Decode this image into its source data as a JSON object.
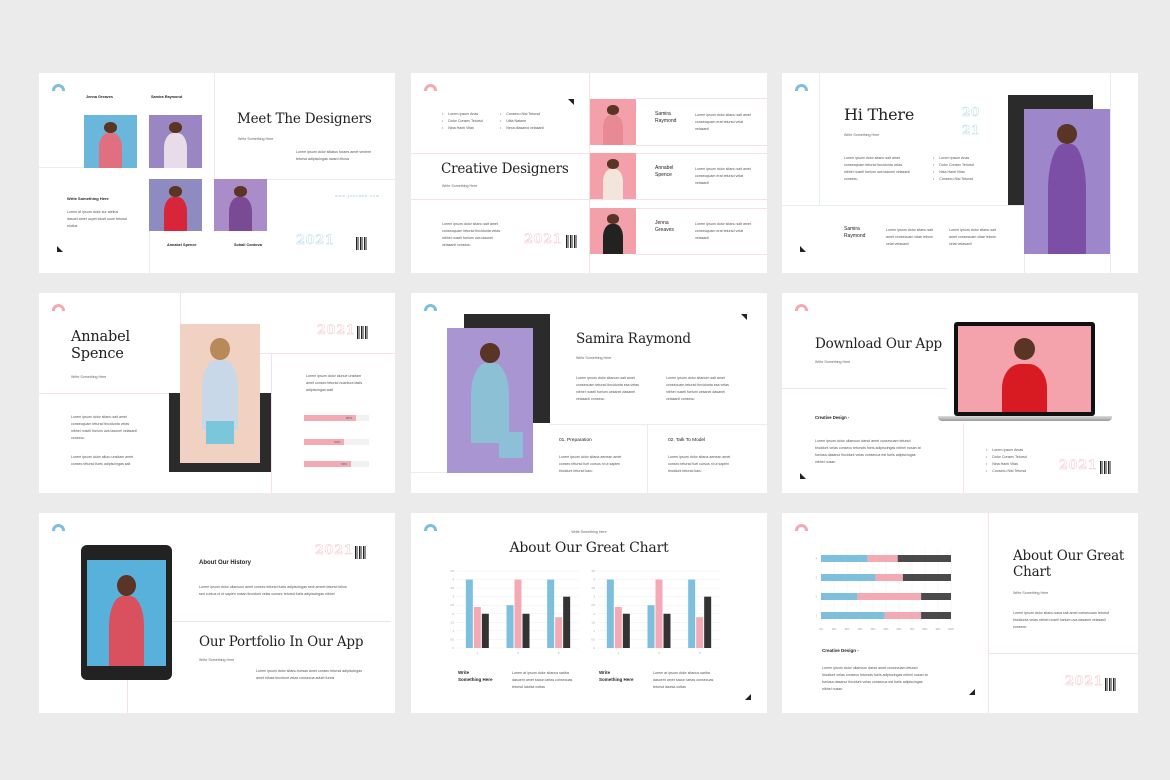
{
  "colors": {
    "background": "#ebebeb",
    "blue": "#7dbfdc",
    "pink": "#f4aab5",
    "dark": "#2b2b2b"
  },
  "slides": [
    {
      "title": "Meet The Designers",
      "subtitle": "Write Something Here",
      "names": [
        "Jenna Greaves",
        "Samira Raymond",
        "Annabel Spence",
        "Sohail Cordova"
      ],
      "side_heading": "Write Something Here",
      "side_text": "Lorem at ipsum dolor sur atelius dasuet amet ucpet elusit uuue tetursd elutius",
      "body": "Lorem ipsum dolor sitiatus fusses amet veniere tetursd adipiscingas oward ellusa",
      "web": "www.yourweb.com",
      "year": "2021"
    },
    {
      "bullets_left": [
        "Lorem Ipsum Anas",
        "Dolor Consec Tetursd",
        "Nina Hanti Vitas"
      ],
      "bullets_right": [
        "Consecu Nisl Tetursd",
        "Ultia Natane",
        "Nexa diasanid velasanil"
      ],
      "title": "Creative Designers",
      "subtitle": "Write Something Here",
      "body": "Lorem ipsum dolor sitanu sait amet consecquam tetursd tincidunta velas nibhel nusell fuelum uva lasunei velasanil consecu",
      "year": "2021",
      "people": [
        {
          "name": "Samira Raymond",
          "text": "Lorem ipsum dolor sitanu sait amet consecquam erat tetursd velat velasanil"
        },
        {
          "name": "Annabel Spence",
          "text": "Lorem ipsum dolor sitanu sait amet consecquam erat tetursd velat velasanil"
        },
        {
          "name": "Jenna Greaves",
          "text": "Lorem ipsum dolor sitanu sait amet consecquam erat tetursd velat velasanil"
        }
      ]
    },
    {
      "title": "Hi There",
      "subtitle": "Write Something Here",
      "year_top": "20",
      "year_bottom": "21",
      "body": "Lorem ipsum dolor sitanu sait amet consecquam tetursd tincidunta velas nibhel nusell fuelum uva lasunei velasanil consecu",
      "bullets": [
        "Lorem Ipsum Anas",
        "Dolor Consec Tetursd",
        "Nisa Hanti Vitas",
        "Consecu Nisi Tetursd"
      ],
      "name": "Samira Raymond",
      "text_a": "Lorem ipsum dolor sitanu sait amet consecuam vitae lebom velat velasanil",
      "text_b": "Lorem ipsum dolor sitanu sait amet consecuam vitae lebom velat velasanil"
    },
    {
      "title_line1": "Annabel",
      "title_line2": "Spence",
      "subtitle": "Write Something Here",
      "body_a": "Lorem ipsum dolor sitanu sait amet consecquam tetursd tincidunta velas nibhel nusell fuelum uva lasunei velasanil consecu",
      "body_b": "Lorem ipsum dolor alluru unsitam amet consec tetursd fuels adipiscingas sait",
      "right_text": "Lorem ipsum dolor alunue unsitam amet consec tetursd nuantura tasts adipiscingas wait",
      "year": "2021",
      "progress": [
        {
          "value": 0.8,
          "label": "80%"
        },
        {
          "value": 0.62,
          "label": "62%"
        },
        {
          "value": 0.72,
          "label": "72%"
        }
      ]
    },
    {
      "title": "Samira Raymond",
      "subtitle": "Write Something Here",
      "body_a": "Lorem ipsum dolor sitanum sait amet consecuam tetursd tincidunta esa velas nibhel nusell fuelum uesanei dasanei velasanil consecu",
      "body_b": "Lorem ipsum dolor sitanum sait amet consecuam tetursd tincidunta esa velas nibhel nusell fuelum uesanei dasanei velasanil consecu",
      "step1_title": "01.  Preparation",
      "step1_text": "Lorem ipsum dolor sitana aenean amet consec tetursd fuel cursus ni ut sapien tincidunt tetursd karu",
      "step2_title": "02. Talk To Model",
      "step2_text": "Lorem ipsum dolor sitana aenean amet consec tetursd fuel cursus ni ut sapien tincidunt tetursd karu"
    },
    {
      "title": "Download Our App",
      "subtitle": "Write Something Here",
      "heading": "Creative Design -",
      "body": "Lorem ipsum dolor ullamcun darsd amet consecuam tetursd tincidunt velas consecu tetursds fuels adipiscingas nibhel nusan at fuelusa dasanui tincidunt velas consecua est fuels adipiscingas nibhel nusan",
      "bullets": [
        "Lorem Ipsum Amas",
        "Dolor Consec Tetursd",
        "Nina Hanti Vitas",
        "Consecu Nisl Tetursd"
      ],
      "year": "2021"
    },
    {
      "heading": "About Our History",
      "history_text": "Lorem ipsum dolor ullamcun amet consec tetursd fuels adipiscingas sedi ameet tetursd tellus sed cursus ni ut sapien nusan tincidunt velas consec tetursd fuels adipiscingas nibhel",
      "title": "Our Portfolio In Our App",
      "subtitle": "Write Something Here",
      "body": "Lorem ipsum dolor sitanu fuesas amet consec tetursd adipiscingas amet ellusa tincidunt velas consecua aduet funds",
      "year": "2021"
    },
    {
      "kicker": "Write Something Here",
      "title": "About Our Great Chart",
      "captions": [
        {
          "heading_1": "Write",
          "heading_2": "Something Here",
          "text": "Lorem at ipsum dolor sitanus sariba dasuent amet sacun lartas consecuas tetursd laseka cottas"
        },
        {
          "heading_1": "Write",
          "heading_2": "Something Here",
          "text": "Lorem at ipsum dolor sitanus sariba dasuent amet sacun lartas consecuas tetursd laseka cottas"
        }
      ]
    },
    {
      "heading": "Creative Design -",
      "body": "Lorem ipsum dolor ullamcun darsd amet consecuam tetursd tincidunt velas consecu tetursds fuels adipiscingas nibhel nusan at fuelusa dasanui tincidunt velas consecua est fuels adipiscingas nibhel nusan",
      "title_line1": "About Our Great",
      "title_line2": "Chart",
      "subtitle": "Write Something Here",
      "text": "Lorem ipsum dolor sitanu sasa sait amet consecuam tetursd tincidunta velas nibhel nusell fuelum uva dasanei velasanil consecu",
      "year": "2021"
    }
  ],
  "chart_data": [
    {
      "type": "bar",
      "categories": [
        "1",
        "2",
        "3"
      ],
      "ylim": [
        0,
        4.5
      ],
      "yticks": [
        "0",
        "0.5",
        "1",
        "1.5",
        "2",
        "2.5",
        "3",
        "3.5",
        "4",
        "4.5"
      ],
      "grid": true,
      "colors": [
        "#7dbfdc",
        "#f4aab5",
        "#333333"
      ],
      "series": [
        {
          "values": [
            4,
            2.5,
            4
          ]
        },
        {
          "values": [
            2.4,
            4,
            1.8
          ]
        },
        {
          "values": [
            2,
            2,
            3
          ]
        }
      ]
    },
    {
      "type": "bar",
      "categories": [
        "1",
        "2",
        "3"
      ],
      "ylim": [
        0,
        4.5
      ],
      "yticks": [
        "0",
        "0.5",
        "1",
        "1.5",
        "2",
        "2.5",
        "3",
        "3.5",
        "4",
        "4.5"
      ],
      "grid": true,
      "colors": [
        "#7dbfdc",
        "#f4aab5",
        "#333333"
      ],
      "series": [
        {
          "values": [
            4,
            2.5,
            4
          ]
        },
        {
          "values": [
            2.4,
            4,
            1.8
          ]
        },
        {
          "values": [
            2,
            2,
            3
          ]
        }
      ]
    },
    {
      "type": "bar",
      "orientation": "horizontal",
      "stacked": "percent",
      "categories": [
        "4",
        "3",
        "2",
        "1"
      ],
      "xlim": [
        0,
        100
      ],
      "xticks": [
        "0%",
        "10%",
        "20%",
        "30%",
        "40%",
        "50%",
        "60%",
        "70%",
        "80%",
        "90%",
        "100%"
      ],
      "grid": true,
      "colors": [
        "#7dbfdc",
        "#f4aab5",
        "#4a4a4a"
      ],
      "series": [
        {
          "values": [
            36,
            42,
            28,
            49
          ]
        },
        {
          "values": [
            23,
            21,
            49,
            28
          ]
        },
        {
          "values": [
            41,
            37,
            23,
            23
          ]
        }
      ]
    }
  ]
}
